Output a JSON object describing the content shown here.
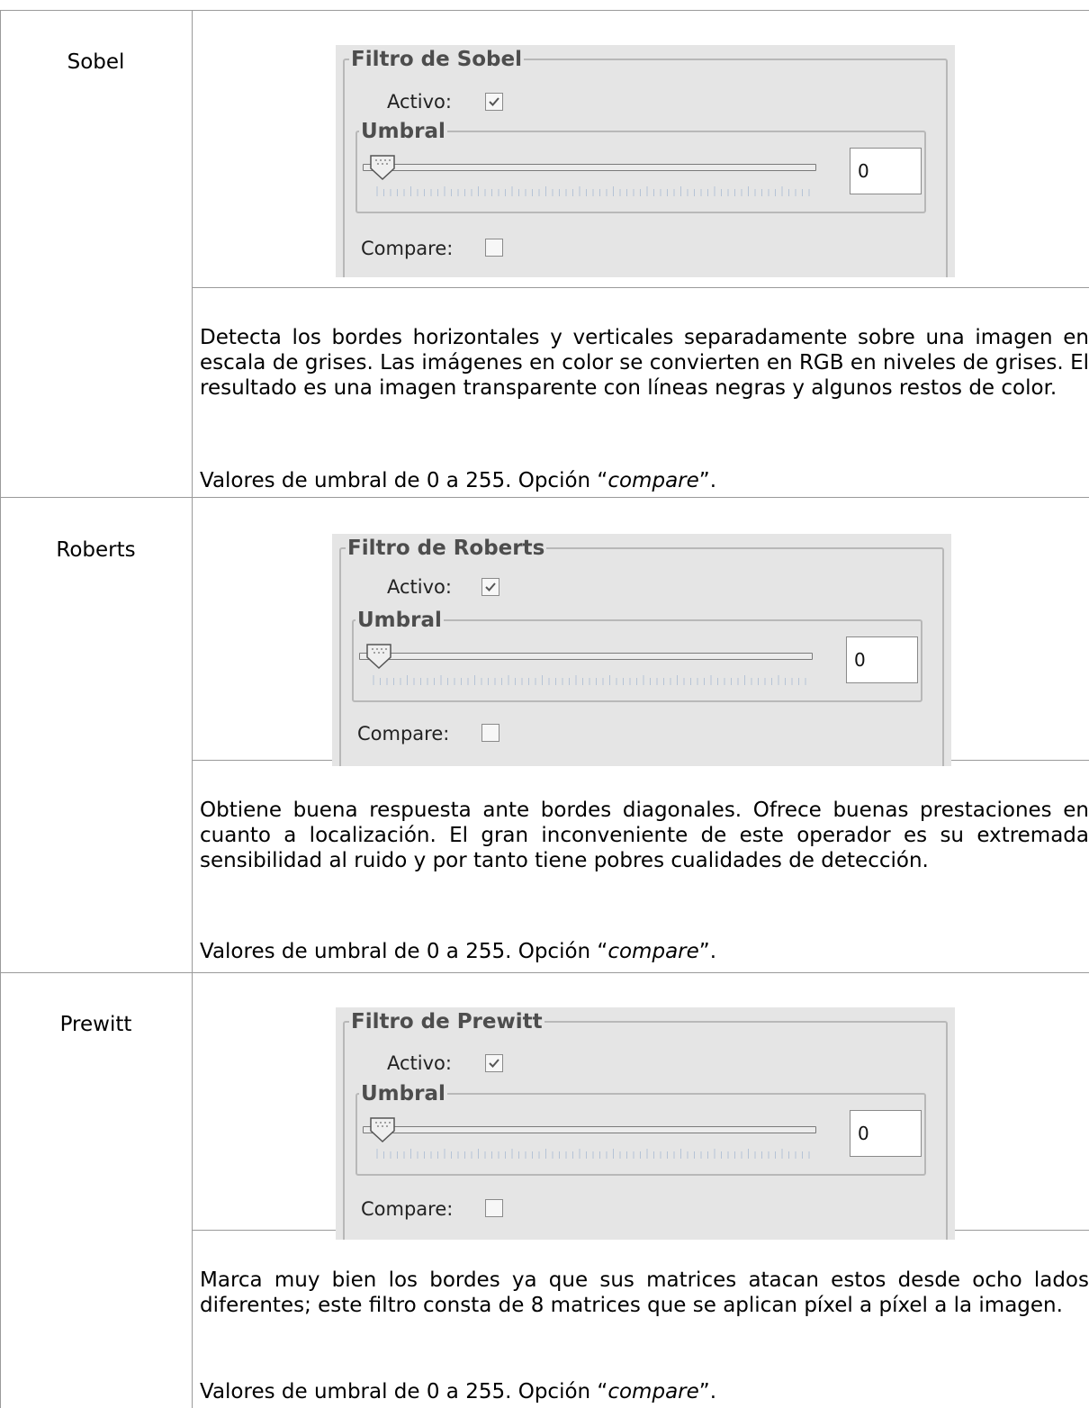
{
  "rows": [
    {
      "name": "Sobel",
      "panel": {
        "title": "Filtro de Sobel",
        "active_label": "Activo:",
        "active_checked": true,
        "threshold_legend": "Umbral",
        "threshold_value": "0",
        "compare_label": "Compare:",
        "compare_checked": false
      },
      "description": "Detecta los bordes horizontales y verticales separadamente sobre una imagen en escala de grises. Las imágenes en color se convierten en RGB en niveles de grises. El resultado es una imagen transparente con líneas negras y algunos restos de color.",
      "range_text": "Valores de umbral de 0 a 255. Opción “",
      "option_word": "compare",
      "range_end": "”."
    },
    {
      "name": "Roberts",
      "panel": {
        "title": "Filtro de Roberts",
        "active_label": "Activo:",
        "active_checked": true,
        "threshold_legend": "Umbral",
        "threshold_value": "0",
        "compare_label": "Compare:",
        "compare_checked": false
      },
      "description": "Obtiene buena respuesta ante bordes diagonales. Ofrece buenas prestaciones en cuanto a localización. El gran inconveniente de este operador es su extremada sensibilidad al ruido y por tanto tiene pobres cualidades de detección.",
      "range_text": "Valores de umbral de 0 a 255. Opción “",
      "option_word": "compare",
      "range_end": "”."
    },
    {
      "name": "Prewitt",
      "panel": {
        "title": "Filtro de Prewitt",
        "active_label": "Activo:",
        "active_checked": true,
        "threshold_legend": "Umbral",
        "threshold_value": "0",
        "compare_label": "Compare:",
        "compare_checked": false
      },
      "description": "Marca muy bien los bordes ya que sus matrices atacan estos desde ocho lados diferentes; este filtro consta de 8 matrices que se aplican píxel a píxel a la imagen.",
      "range_text": "Valores de umbral de 0 a 255. Opción “",
      "option_word": "compare",
      "range_end": "”."
    }
  ]
}
